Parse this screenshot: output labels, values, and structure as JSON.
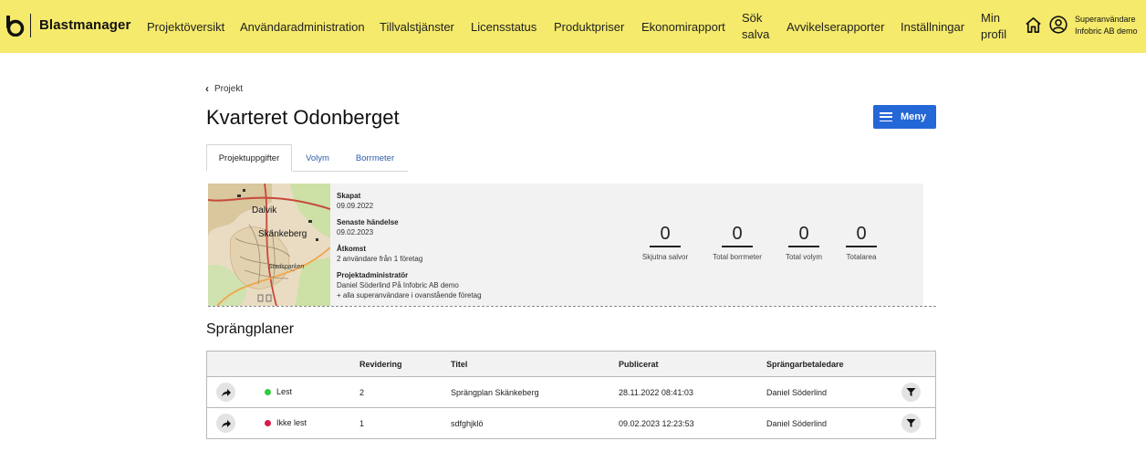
{
  "app": {
    "name": "Blastmanager"
  },
  "nav": {
    "items": [
      "Projektöversikt",
      "Användaradministration",
      "Tillvalstjänster",
      "Licensstatus",
      "Produktpriser",
      "Ekonomirapport",
      "Sök salva",
      "Avvikelserapporter",
      "Inställningar",
      "Min profil"
    ],
    "user_line1": "Superanvändare",
    "user_line2": "Infobric AB demo"
  },
  "breadcrumb": {
    "label": "Projekt"
  },
  "page": {
    "title": "Kvarteret Odonberget",
    "menu_label": "Meny"
  },
  "tabs": [
    "Projektuppgifter",
    "Volym",
    "Borrmeter"
  ],
  "map": {
    "labels": [
      "Dalvik",
      "Skänkeberg",
      "Stadsparken"
    ]
  },
  "project": {
    "created_label": "Skapat",
    "created_value": "09.09.2022",
    "last_event_label": "Senaste händelse",
    "last_event_value": "09.02.2023",
    "access_label": "Åtkomst",
    "access_value": "2 användare från 1 företag",
    "admin_label": "Projektadministratör",
    "admin_value": "Daniel Söderlind På Infobric AB demo",
    "admin_note": "+ alla superanvändare i ovanstående företag"
  },
  "stats": [
    {
      "value": "0",
      "label": "Skjutna salvor"
    },
    {
      "value": "0",
      "label": "Total borrmeter"
    },
    {
      "value": "0",
      "label": "Total volym"
    },
    {
      "value": "0",
      "label": "Totalarea"
    }
  ],
  "section": {
    "title": "Sprängplaner"
  },
  "table": {
    "headers": [
      "Revidering",
      "Titel",
      "Publicerat",
      "Sprängarbetaledare"
    ],
    "rows": [
      {
        "status": "Lest",
        "status_color": "#2ecc40",
        "revision": "2",
        "title": "Sprängplan Skänkeberg",
        "published": "28.11.2022 08:41:03",
        "leader": "Daniel Söderlind"
      },
      {
        "status": "Ikke lest",
        "status_color": "#d81b47",
        "revision": "1",
        "title": "sdfghjklö",
        "published": "09.02.2023 12:23:53",
        "leader": "Daniel Söderlind"
      }
    ]
  },
  "colors": {
    "topbar": "#f5ea6b",
    "accent": "#2467d6"
  }
}
